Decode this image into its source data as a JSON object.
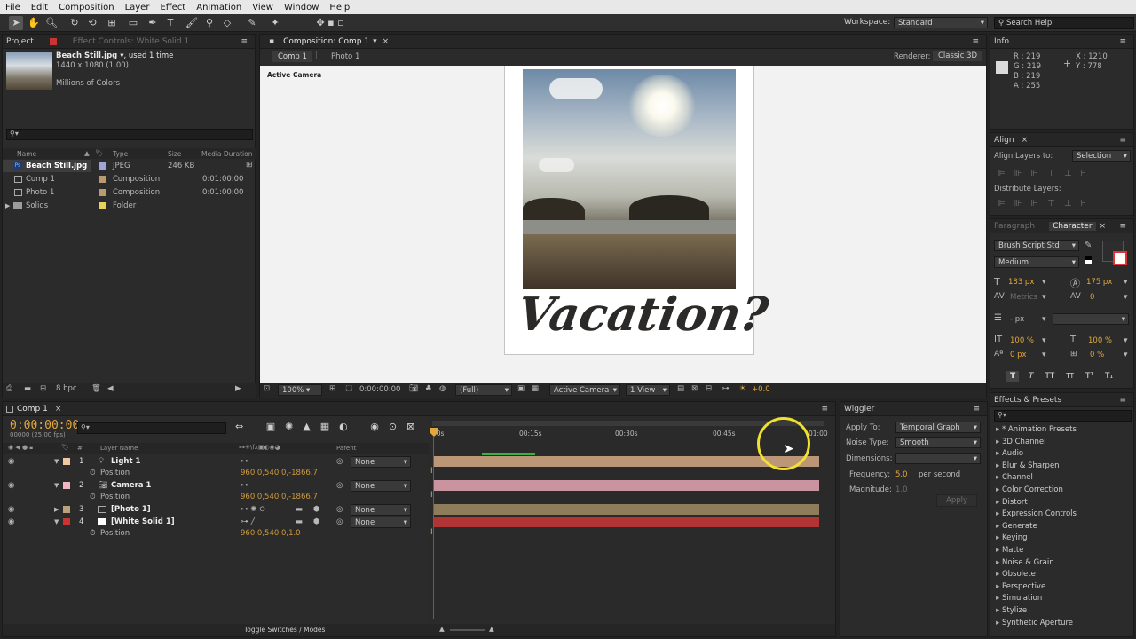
{
  "menu": [
    "File",
    "Edit",
    "Composition",
    "Layer",
    "Effect",
    "Animation",
    "View",
    "Window",
    "Help"
  ],
  "workspace": {
    "label": "Workspace:",
    "value": "Standard",
    "search_placeholder": "Search Help"
  },
  "project": {
    "tab": "Project",
    "tab2": "Effect Controls: White Solid 1",
    "footage_name": "Beach Still.jpg ▾",
    "footage_used": ", used 1 time",
    "footage_dims": "1440 x 1080 (1.00)",
    "footage_colors": "Millions of Colors",
    "columns": [
      "Name",
      "Type",
      "Size",
      "Media Duration"
    ],
    "items": [
      {
        "name": "Beach Still.jpg",
        "type": "JPEG",
        "size": "246 KB",
        "duration": "",
        "color": "#9fa3d6",
        "icon": "Ps"
      },
      {
        "name": "Comp 1",
        "type": "Composition",
        "size": "",
        "duration": "0:01:00:00",
        "color": "#b99a6e",
        "icon": "comp"
      },
      {
        "name": "Photo 1",
        "type": "Composition",
        "size": "",
        "duration": "0:01:00:00",
        "color": "#b99a6e",
        "icon": "comp"
      },
      {
        "name": "Solids",
        "type": "Folder",
        "size": "",
        "duration": "",
        "color": "#e8d15a",
        "icon": "folder"
      }
    ],
    "bpc": "8 bpc"
  },
  "composition": {
    "tab": "Composition: Comp 1",
    "crumbs": [
      "Comp 1",
      "Photo 1"
    ],
    "renderer_label": "Renderer:",
    "renderer": "Classic 3D",
    "view_label": "Active Camera",
    "photo_caption": "Vacation?",
    "zoom": "100%",
    "timecode": "0:00:00:00",
    "resolution": "(Full)",
    "camera": "Active Camera",
    "views": "1 View",
    "exposure": "+0.0"
  },
  "info": {
    "tab": "Info",
    "r": "R : 219",
    "g": "G : 219",
    "b": "B : 219",
    "a": "A : 255",
    "x": "X : 1210",
    "y": "Y : 778"
  },
  "align": {
    "tab": "Align",
    "align_to_label": "Align Layers to:",
    "align_to": "Selection",
    "distribute_label": "Distribute Layers:"
  },
  "character": {
    "tabs": [
      "Paragraph",
      "Character"
    ],
    "font": "Brush Script Std",
    "style": "Medium",
    "size": "183 px",
    "leading": "175 px",
    "kerning": "Metrics",
    "tracking": "0",
    "stroke": "- px",
    "vscale": "100 %",
    "hscale": "100 %",
    "baseline": "0 px",
    "tsume": "0 %",
    "style_buttons": [
      "T",
      "T",
      "TT",
      "TT",
      "T¹",
      "T₁"
    ]
  },
  "timeline": {
    "tab": "Comp 1",
    "timecode": "0:00:00:00",
    "fps": "00000 (25.00 fps)",
    "columns": {
      "layer": "Layer Name",
      "parent": "Parent",
      "num": "#"
    },
    "ruler": [
      "00s",
      "00:15s",
      "00:30s",
      "00:45s",
      "01:00"
    ],
    "layers": [
      {
        "num": "1",
        "name": "Light 1",
        "color": "#f0c7a0",
        "parent": "None",
        "prop": "Position",
        "value": "960.0,540.0,-1866.7",
        "bar": "#bb9677"
      },
      {
        "num": "2",
        "name": "Camera 1",
        "color": "#f0b6c6",
        "parent": "None",
        "prop": "Position",
        "value": "960.0,540.0,-1866.7",
        "bar": "#c9939f"
      },
      {
        "num": "3",
        "name": "[Photo 1]",
        "color": "#bba27a",
        "parent": "None",
        "prop": "",
        "value": "",
        "bar": "#8f7c5b"
      },
      {
        "num": "4",
        "name": "[White Solid 1]",
        "color": "#cc3333",
        "parent": "None",
        "prop": "Position",
        "value": "960.0,540.0,1.0",
        "bar": "#b23434"
      }
    ],
    "toggle": "Toggle Switches / Modes"
  },
  "wiggler": {
    "tab": "Wiggler",
    "apply_to_label": "Apply To:",
    "apply_to": "Temporal Graph",
    "noise_label": "Noise Type:",
    "noise": "Smooth",
    "dims_label": "Dimensions:",
    "freq_label": "Frequency:",
    "freq": "5.0",
    "freq_unit": "per second",
    "mag_label": "Magnitude:",
    "mag": "1.0",
    "apply_button": "Apply"
  },
  "effects": {
    "tab": "Effects & Presets",
    "items": [
      "* Animation Presets",
      "3D Channel",
      "Audio",
      "Blur & Sharpen",
      "Channel",
      "Color Correction",
      "Distort",
      "Expression Controls",
      "Generate",
      "Keying",
      "Matte",
      "Noise & Grain",
      "Obsolete",
      "Perspective",
      "Simulation",
      "Stylize",
      "Synthetic Aperture"
    ]
  }
}
